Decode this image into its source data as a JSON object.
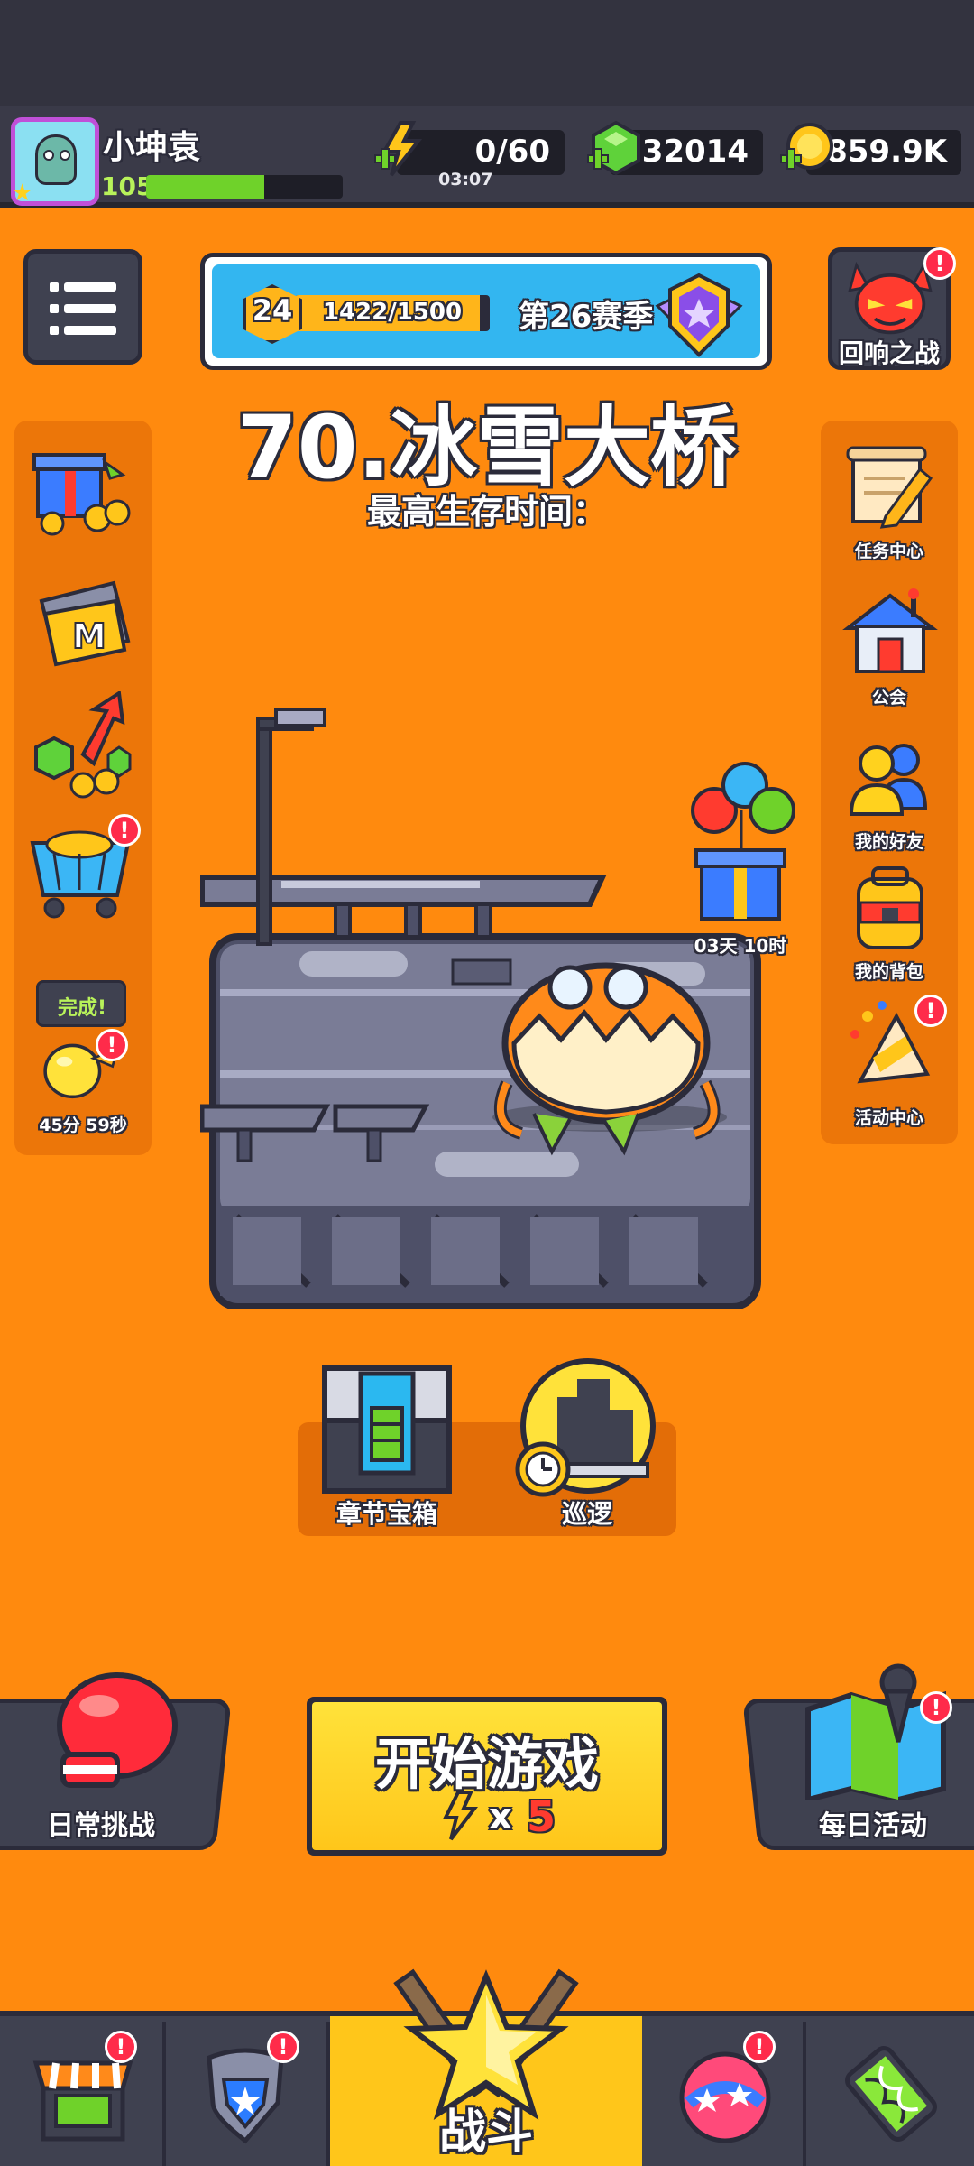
{
  "player": {
    "name": "小坤袁",
    "level": "105",
    "xp_fraction": 0.6
  },
  "resources": {
    "energy": "0/60",
    "energy_timer": "03:07",
    "gems": "32014",
    "coins": "859.9K"
  },
  "season": {
    "level": "24",
    "progress_text": "1422/1500",
    "progress_fraction": 0.948,
    "label": "第26赛季"
  },
  "stage": {
    "title": "70.冰雪大桥",
    "subtitle": "最高生存时间："
  },
  "left_column": {
    "items": [
      {
        "icon": "gift-box-icon"
      },
      {
        "icon": "m-card-icon"
      },
      {
        "icon": "growth-fund-icon"
      },
      {
        "icon": "shop-cart-icon",
        "alert": "!"
      },
      {
        "icon": "idle-reward-icon",
        "bubble": "完成!",
        "alert": "!",
        "label": "45分 59秒"
      }
    ]
  },
  "right_column": {
    "echo_battle": {
      "label": "回响之战",
      "alert": "!"
    },
    "items": [
      {
        "icon": "scroll-icon",
        "label": "任务中心"
      },
      {
        "icon": "guild-house-icon",
        "label": "公会"
      },
      {
        "icon": "friends-icon",
        "label": "我的好友"
      },
      {
        "icon": "backpack-icon",
        "label": "我的背包"
      },
      {
        "icon": "party-horn-icon",
        "label": "活动中心",
        "alert": "!"
      }
    ]
  },
  "balloon_gift": {
    "label": "03天 10时"
  },
  "chapter_chest": {
    "label": "章节宝箱"
  },
  "patrol": {
    "label": "巡逻"
  },
  "daily_challenge": {
    "label": "日常挑战"
  },
  "daily_activity": {
    "label": "每日活动",
    "alert": "!"
  },
  "start_game": {
    "label": "开始游戏",
    "cost_prefix": "x",
    "cost": "5"
  },
  "bottom_nav": {
    "tabs": [
      {
        "icon": "shop-icon",
        "alert": "!"
      },
      {
        "icon": "equipment-shield-icon",
        "alert": "!"
      },
      {
        "icon": "battle-star-icon",
        "label": "战斗"
      },
      {
        "icon": "talent-orb-icon",
        "alert": "!"
      },
      {
        "icon": "dna-evolution-icon"
      }
    ]
  },
  "colors": {
    "background": "#ff8a0e",
    "dark_panel": "#3f4150",
    "outline": "#2b2b3a",
    "accent_yellow": "#ffc61a",
    "alert_red": "#ff2b4a",
    "season_blue": "#33b6f0",
    "energy_green": "#6fd22a"
  }
}
